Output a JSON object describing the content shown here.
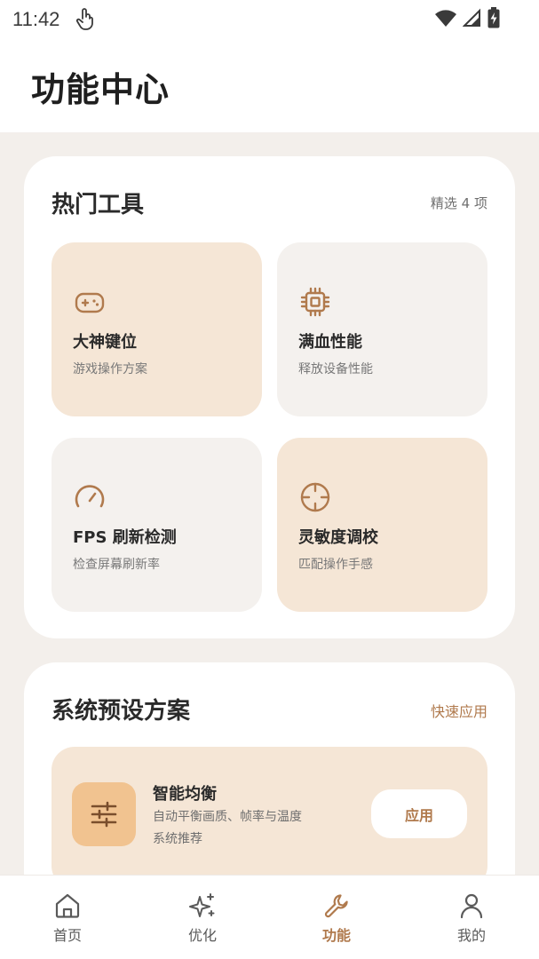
{
  "status": {
    "time": "11:42"
  },
  "header": {
    "title": "功能中心"
  },
  "hot_tools": {
    "title": "热门工具",
    "meta": "精选 4 项",
    "items": [
      {
        "title": "大神键位",
        "subtitle": "游戏操作方案",
        "icon": "gamepad-icon"
      },
      {
        "title": "满血性能",
        "subtitle": "释放设备性能",
        "icon": "chip-icon"
      },
      {
        "title": "FPS 刷新检测",
        "subtitle": "检查屏幕刷新率",
        "icon": "speedometer-icon"
      },
      {
        "title": "灵敏度调校",
        "subtitle": "匹配操作手感",
        "icon": "crosshair-icon"
      }
    ]
  },
  "presets": {
    "title": "系统预设方案",
    "link": "快速应用",
    "items": [
      {
        "title": "智能均衡",
        "description": "自动平衡画质、帧率与温度",
        "note": "系统推荐",
        "button": "应用",
        "icon": "sliders-icon"
      }
    ]
  },
  "nav": {
    "items": [
      {
        "label": "首页",
        "icon": "home-icon"
      },
      {
        "label": "优化",
        "icon": "sparkle-icon"
      },
      {
        "label": "功能",
        "icon": "wrench-icon"
      },
      {
        "label": "我的",
        "icon": "user-icon"
      }
    ],
    "active_index": 2
  },
  "colors": {
    "accent": "#b07a4d",
    "warm_card": "#f5e6d6",
    "light_card": "#f4f1ee",
    "preset_icon_bg": "#f1c390",
    "page_bg": "#f3efeb"
  }
}
